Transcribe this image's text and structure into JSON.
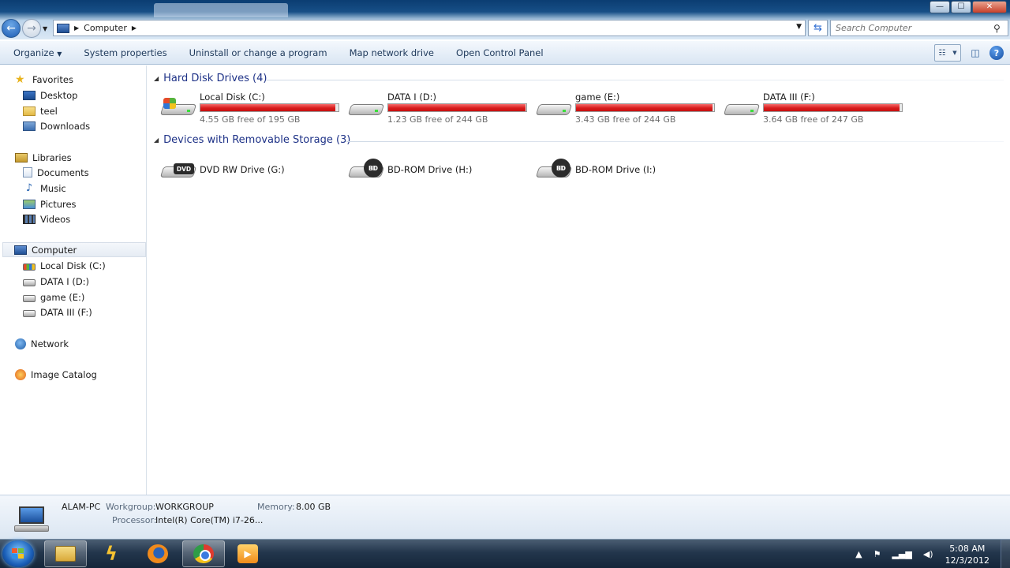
{
  "address": {
    "crumb": "Computer"
  },
  "search": {
    "placeholder": "Search Computer"
  },
  "window_buttons": {
    "minimize": "—",
    "maximize": "☐",
    "close": "✕"
  },
  "toolbar": {
    "organize": "Organize",
    "system_properties": "System properties",
    "uninstall": "Uninstall or change a program",
    "map_drive": "Map network drive",
    "control_panel": "Open Control Panel"
  },
  "sidebar": {
    "favorites": {
      "label": "Favorites",
      "items": [
        "Desktop",
        "teel",
        "Downloads"
      ]
    },
    "libraries": {
      "label": "Libraries",
      "items": [
        "Documents",
        "Music",
        "Pictures",
        "Videos"
      ]
    },
    "computer": {
      "label": "Computer",
      "items": [
        "Local Disk (C:)",
        "DATA I (D:)",
        "game (E:)",
        "DATA III (F:)"
      ]
    },
    "network": "Network",
    "image_catalog": "Image Catalog"
  },
  "content": {
    "hdd_group": "Hard Disk Drives (4)",
    "hdd": [
      {
        "name": "Local Disk (C:)",
        "free": "4.55 GB free of 195 GB",
        "used_fraction": 0.977
      },
      {
        "name": "DATA I (D:)",
        "free": "1.23 GB free of 244 GB",
        "used_fraction": 0.995
      },
      {
        "name": "game (E:)",
        "free": "3.43 GB free of 244 GB",
        "used_fraction": 0.986
      },
      {
        "name": "DATA III (F:)",
        "free": "3.64 GB free of 247 GB",
        "used_fraction": 0.985
      }
    ],
    "removable_group": "Devices with Removable Storage (3)",
    "removable": [
      {
        "name": "DVD RW Drive (G:)",
        "badge": "DVD"
      },
      {
        "name": "BD-ROM Drive (H:)",
        "badge": "BD"
      },
      {
        "name": "BD-ROM Drive (I:)",
        "badge": "BD"
      }
    ]
  },
  "details": {
    "pc_name": "ALAM-PC",
    "workgroup_label": "Workgroup:",
    "workgroup": "WORKGROUP",
    "memory_label": "Memory:",
    "memory": "8.00 GB",
    "processor_label": "Processor:",
    "processor": "Intel(R) Core(TM) i7-26..."
  },
  "taskbar": {
    "time": "5:08 AM",
    "date": "12/3/2012"
  },
  "colors": {
    "bar_fill": "#d61c1c",
    "group_heading": "#1e3287",
    "accent": "#1e395b"
  }
}
